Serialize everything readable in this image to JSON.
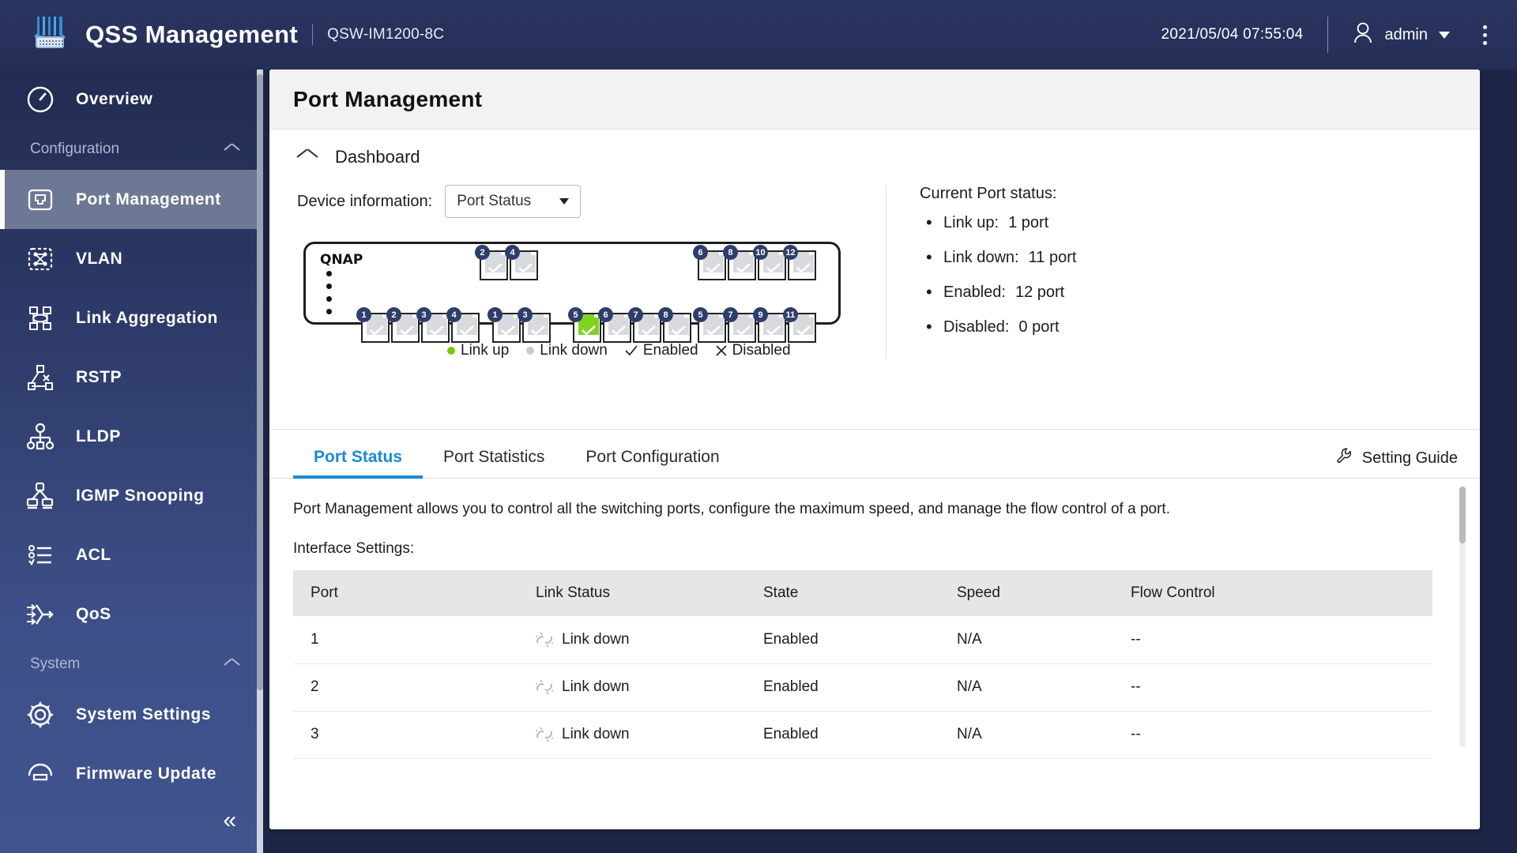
{
  "header": {
    "app_title": "QSS Management",
    "model": "QSW-IM1200-8C",
    "datetime": "2021/05/04 07:55:04",
    "user": "admin",
    "brand_icon": "switch-icon",
    "user_icon": "person-icon",
    "menu_icon": "kebab-menu-icon"
  },
  "sidebar": {
    "overview": {
      "label": "Overview",
      "icon": "gauge-icon"
    },
    "groups": [
      {
        "label": "Configuration",
        "icon": "chevron-up-icon"
      },
      {
        "label": "System",
        "icon": "chevron-up-icon"
      }
    ],
    "config_items": [
      {
        "label": "Port Management",
        "icon": "ethernet-port-icon",
        "active": true
      },
      {
        "label": "VLAN",
        "icon": "vlan-network-icon",
        "active": false
      },
      {
        "label": "Link Aggregation",
        "icon": "link-aggregation-icon",
        "active": false
      },
      {
        "label": "RSTP",
        "icon": "rstp-tree-icon",
        "active": false
      },
      {
        "label": "LLDP",
        "icon": "lldp-hierarchy-icon",
        "active": false
      },
      {
        "label": "IGMP Snooping",
        "icon": "igmp-snooping-icon",
        "active": false
      },
      {
        "label": "ACL",
        "icon": "acl-list-icon",
        "active": false
      },
      {
        "label": "QoS",
        "icon": "qos-arrows-icon",
        "active": false
      }
    ],
    "system_items": [
      {
        "label": "System Settings",
        "icon": "gear-icon"
      },
      {
        "label": "Firmware Update",
        "icon": "firmware-update-icon"
      }
    ],
    "collapse_icon": "double-chevron-left-icon"
  },
  "page": {
    "title": "Port Management"
  },
  "dashboard": {
    "title": "Dashboard",
    "collapse_icon": "chevron-up-icon",
    "device_info_label": "Device information:",
    "device_info_value": "Port Status",
    "device_info_options": [
      "Port Status"
    ],
    "switch_brand": "QNAP",
    "legend": [
      {
        "label": "Link up",
        "marker": "green-dot"
      },
      {
        "label": "Link down",
        "marker": "gray-dot"
      },
      {
        "label": "Enabled",
        "marker": "check-mark"
      },
      {
        "label": "Disabled",
        "marker": "cross-mark"
      }
    ],
    "ports": {
      "top_groups": [
        {
          "offset": 150,
          "ports": [
            {
              "num": "2",
              "state": "down"
            },
            {
              "num": "4",
              "state": "down"
            }
          ]
        },
        {
          "offset": 410,
          "ports": [
            {
              "num": "6",
              "state": "down"
            },
            {
              "num": "8",
              "state": "down"
            },
            {
              "num": "10",
              "state": "down"
            },
            {
              "num": "12",
              "state": "down"
            }
          ]
        }
      ],
      "bottom_groups": [
        {
          "offset": 0,
          "ports": [
            {
              "num": "1",
              "state": "down"
            },
            {
              "num": "2",
              "state": "down"
            },
            {
              "num": "3",
              "state": "down"
            },
            {
              "num": "4",
              "state": "down"
            }
          ]
        },
        {
          "offset": 150,
          "ports": [
            {
              "num": "1",
              "state": "down"
            },
            {
              "num": "3",
              "state": "down"
            }
          ]
        },
        {
          "offset": 252,
          "ports": [
            {
              "num": "5",
              "state": "up"
            },
            {
              "num": "6",
              "state": "down"
            },
            {
              "num": "7",
              "state": "down"
            },
            {
              "num": "8",
              "state": "down"
            }
          ]
        },
        {
          "offset": 410,
          "ports": [
            {
              "num": "5",
              "state": "down"
            },
            {
              "num": "7",
              "state": "down"
            },
            {
              "num": "9",
              "state": "down"
            },
            {
              "num": "11",
              "state": "down"
            }
          ]
        }
      ]
    },
    "status_title": "Current Port status:",
    "status_items": [
      {
        "label": "Link up:",
        "value": "1 port"
      },
      {
        "label": "Link down:",
        "value": "11 port"
      },
      {
        "label": "Enabled:",
        "value": "12 port"
      },
      {
        "label": "Disabled:",
        "value": "0 port"
      }
    ]
  },
  "tabs": [
    {
      "label": "Port Status",
      "active": true
    },
    {
      "label": "Port Statistics",
      "active": false
    },
    {
      "label": "Port Configuration",
      "active": false
    }
  ],
  "setting_guide": {
    "label": "Setting Guide",
    "icon": "wrench-icon"
  },
  "content": {
    "description": "Port Management allows you to control all the switching ports, configure the maximum speed, and manage the flow control of a port.",
    "sub_label": "Interface Settings:",
    "table": {
      "columns": [
        "Port",
        "Link Status",
        "State",
        "Speed",
        "Flow Control"
      ],
      "rows": [
        {
          "port": "1",
          "link_status": "Link down",
          "link_icon": "broken-link-icon",
          "state": "Enabled",
          "speed": "N/A",
          "flow_control": "--"
        },
        {
          "port": "2",
          "link_status": "Link down",
          "link_icon": "broken-link-icon",
          "state": "Enabled",
          "speed": "N/A",
          "flow_control": "--"
        },
        {
          "port": "3",
          "link_status": "Link down",
          "link_icon": "broken-link-icon",
          "state": "Enabled",
          "speed": "N/A",
          "flow_control": "--"
        }
      ]
    }
  },
  "colors": {
    "header_bg": "#28325c",
    "sidebar_top": "#232c52",
    "sidebar_bottom": "#42548e",
    "accent_blue": "#1a8ad6",
    "link_up_green": "#7ed321",
    "active_nav_bg": "#6d7894"
  }
}
